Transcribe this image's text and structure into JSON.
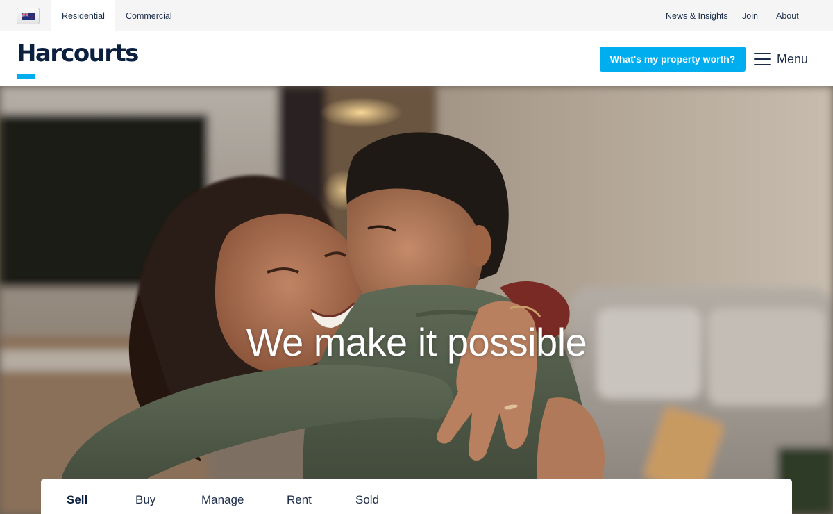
{
  "utility_bar": {
    "country_flag": "new-zealand-flag-icon",
    "segments": [
      {
        "label": "Residential",
        "active": true
      },
      {
        "label": "Commercial",
        "active": false
      }
    ],
    "links": [
      "News & Insights",
      "Join",
      "About"
    ]
  },
  "header": {
    "logo_text": "Harcourts",
    "cta_label": "What's my property worth?",
    "menu_label": "Menu"
  },
  "hero": {
    "headline": "We make it possible"
  },
  "search_tabs": {
    "items": [
      {
        "label": "Sell",
        "active": true
      },
      {
        "label": "Buy",
        "active": false
      },
      {
        "label": "Manage",
        "active": false
      },
      {
        "label": "Rent",
        "active": false
      },
      {
        "label": "Sold",
        "active": false
      }
    ]
  },
  "colors": {
    "brand_navy": "#0b1f3f",
    "accent_blue": "#00adef",
    "utility_bg": "#f5f5f5"
  }
}
